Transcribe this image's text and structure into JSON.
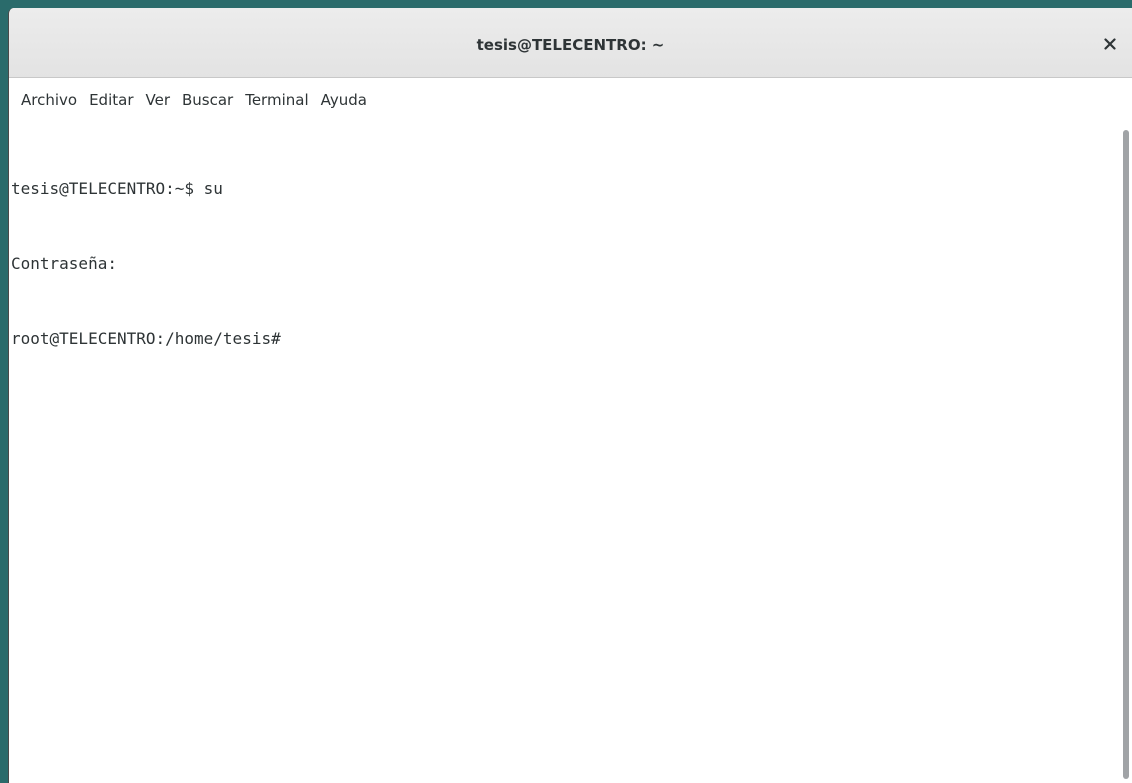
{
  "window": {
    "title": "tesis@TELECENTRO: ~"
  },
  "menubar": {
    "items": [
      {
        "label": "Archivo"
      },
      {
        "label": "Editar"
      },
      {
        "label": "Ver"
      },
      {
        "label": "Buscar"
      },
      {
        "label": "Terminal"
      },
      {
        "label": "Ayuda"
      }
    ]
  },
  "terminal": {
    "lines": [
      "tesis@TELECENTRO:~$ su",
      "Contraseña:",
      "root@TELECENTRO:/home/tesis#"
    ]
  },
  "icons": {
    "close": "close-icon"
  },
  "colors": {
    "desktop": "#2a6b6b",
    "titlebar": "#e8e8e8",
    "text": "#2e3436",
    "terminal_bg": "#ffffff"
  }
}
